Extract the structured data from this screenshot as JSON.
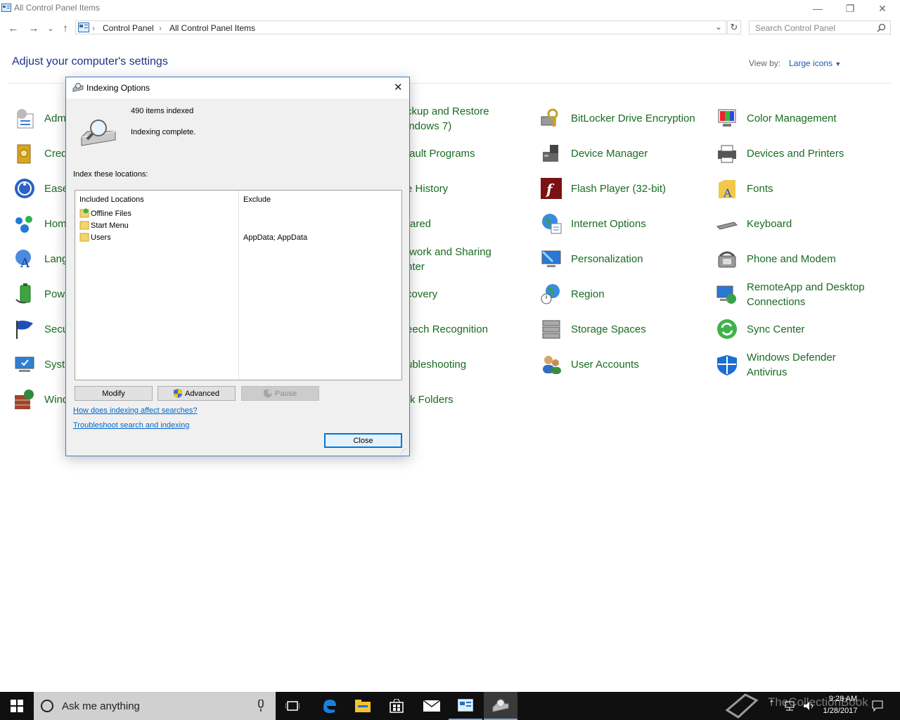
{
  "window": {
    "title": "All Control Panel Items",
    "minimize": "—",
    "restore": "❐",
    "close": "✕"
  },
  "nav": {
    "back": "←",
    "forward": "→",
    "recent": "⌄",
    "up": "↑"
  },
  "address": {
    "crumbs": [
      "Control Panel",
      "All Control Panel Items"
    ],
    "dropdown": "⌄",
    "refresh": "↻"
  },
  "search": {
    "placeholder": "Search Control Panel"
  },
  "header": {
    "title": "Adjust your computer's settings",
    "view_by_label": "View by:",
    "view_by_value": "Large icons"
  },
  "items": {
    "col1": [
      "Adm",
      "Cred",
      "Ease",
      "Hom",
      "Lang",
      "Pow",
      "Secu",
      "Syst",
      "Wind"
    ],
    "col3": [
      "ckup and Restore",
      "indows 7)",
      "fault Programs",
      "e History",
      "rared",
      "twork and Sharing",
      "nter",
      "covery",
      "eech Recognition",
      "ubleshooting",
      "rk Folders"
    ],
    "col4": [
      "BitLocker Drive Encryption",
      "Device Manager",
      "Flash Player (32-bit)",
      "Internet Options",
      "Personalization",
      "Region",
      "Storage Spaces",
      "User Accounts"
    ],
    "col5": [
      "Color Management",
      "Devices and Printers",
      "Fonts",
      "Keyboard",
      "Phone and Modem",
      "RemoteApp and Desktop",
      "Connections",
      "Sync Center",
      "Windows Defender",
      "Antivirus"
    ]
  },
  "dialog": {
    "title": "Indexing Options",
    "close_glyph": "✕",
    "items_indexed": "490 items indexed",
    "status": "Indexing complete.",
    "index_label": "Index these locations:",
    "col_included": "Included Locations",
    "col_exclude": "Exclude",
    "locations": [
      {
        "name": "Offline Files",
        "exclude": ""
      },
      {
        "name": "Start Menu",
        "exclude": ""
      },
      {
        "name": "Users",
        "exclude": "AppData; AppData"
      }
    ],
    "buttons": {
      "modify": "Modify",
      "advanced": "Advanced",
      "pause": "Pause",
      "close": "Close"
    },
    "links": {
      "how": "How does indexing affect searches?",
      "troubleshoot": "Troubleshoot search and indexing"
    }
  },
  "taskbar": {
    "cortana_text": "Ask me anything",
    "time": "9:28 AM",
    "date": "1/28/2017",
    "watermark": "TheCollectionBook"
  },
  "colors": {
    "link_green": "#1a6b22",
    "heading_blue": "#1e3287",
    "dialog_border": "#3b7dd8"
  }
}
